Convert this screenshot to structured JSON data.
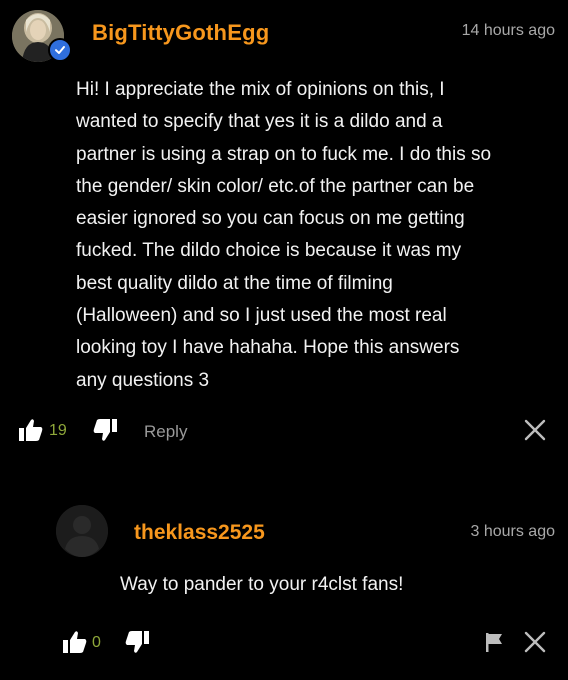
{
  "comment": {
    "username": "BigTittyGothEgg",
    "time": "14 hours ago",
    "text": "Hi! I appreciate the mix of opinions on this, I\nwanted to specify that yes it is a dildo and a\npartner is using a strap on to fuck me. I do this so\nthe gender/ skin color/ etc.of the partner can be\neasier ignored so you can focus on me getting\nfucked. The dildo choice is because it was my\nbest quality dildo at the time of filming\n(Halloween) and so I just used the most real\nlooking toy I have hahaha. Hope this answers\nany questions 3",
    "likes": "19",
    "reply_label": "Reply",
    "verified": true
  },
  "reply_comment": {
    "username": "theklass2525",
    "time": "3 hours ago",
    "text": "Way to pander to your r4clst fans!",
    "likes": "0"
  },
  "colors": {
    "username": "#f7971d",
    "likes_count": "#8fa83a",
    "muted": "#a8a8a8",
    "verified_badge": "#2f6fde"
  },
  "icons": [
    "thumbs-up-icon",
    "thumbs-down-icon",
    "close-icon",
    "flag-icon",
    "verified-check-icon"
  ]
}
